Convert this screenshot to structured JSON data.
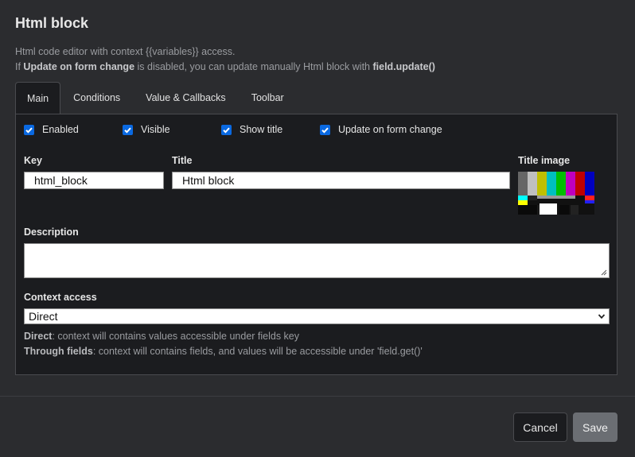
{
  "dialog": {
    "title": "Html block",
    "description_line1": "Html code editor with context {{variables}} access.",
    "description_line2_prefix": "If ",
    "description_line2_bold1": "Update on form change",
    "description_line2_middle": " is disabled, you can update manually Html block with ",
    "description_line2_bold2": "field.update()"
  },
  "tabs": [
    {
      "label": "Main",
      "active": true
    },
    {
      "label": "Conditions",
      "active": false
    },
    {
      "label": "Value & Callbacks",
      "active": false
    },
    {
      "label": "Toolbar",
      "active": false
    }
  ],
  "checkboxes": {
    "enabled": {
      "label": "Enabled",
      "checked": true
    },
    "visible": {
      "label": "Visible",
      "checked": true
    },
    "show_title": {
      "label": "Show title",
      "checked": true
    },
    "update_on_change": {
      "label": "Update on form change",
      "checked": true
    }
  },
  "fields": {
    "key_label": "Key",
    "key_value": "html_block",
    "title_label": "Title",
    "title_value": "Html block",
    "title_image_label": "Title image",
    "description_label": "Description",
    "description_value": "",
    "context_label": "Context access",
    "context_value": "Direct"
  },
  "help": {
    "direct_bold": "Direct",
    "direct_text": ": context will contains values accessible under fields key",
    "through_bold": "Through fields",
    "through_text": ": context will contains fields, and values will be accessible under 'field.get()'"
  },
  "buttons": {
    "cancel": "Cancel",
    "save": "Save"
  },
  "colors": {
    "accent": "#0a69e1",
    "panel_bg": "#1b1c1f",
    "dialog_bg": "#2b2c2f",
    "save_bg": "#6b6e73"
  }
}
